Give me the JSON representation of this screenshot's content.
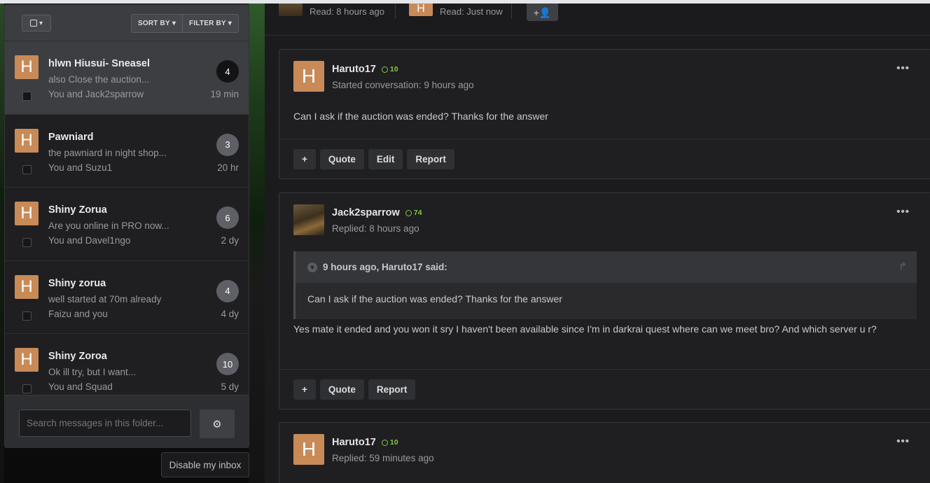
{
  "inbox": {
    "sort_label": "SORT BY",
    "filter_label": "FILTER BY",
    "conversations": [
      {
        "title": "hlwn Hiusui- Sneasel",
        "snippet": "also Close the auction...",
        "who": "You and Jack2sparrow",
        "count": "4",
        "time": "19 min",
        "avatar": "H",
        "active": true
      },
      {
        "title": "Pawniard",
        "snippet": "the pawniard in night shop...",
        "who": "You and Suzu1",
        "count": "3",
        "time": "20 hr",
        "avatar": "H"
      },
      {
        "title": "Shiny Zorua",
        "snippet": "Are you online in PRO now...",
        "who": "You and Davel1ngo",
        "count": "6",
        "time": "2 dy",
        "avatar": "H"
      },
      {
        "title": "Shiny zorua",
        "snippet": "well started at 70m already",
        "who": "Faizu and you",
        "count": "4",
        "time": "4 dy",
        "avatar": "H"
      },
      {
        "title": "Shiny Zoroa",
        "snippet": "Ok ill try, but I want...",
        "who": "You and Squad",
        "count": "10",
        "time": "5 dy",
        "avatar": "H"
      }
    ],
    "search_placeholder": "Search messages in this folder...",
    "disable_label": "Disable my inbox"
  },
  "participants": {
    "first_read": "Read: 8 hours ago",
    "second_read": "Read: Just now",
    "second_avatar": "H"
  },
  "messages": [
    {
      "author": "Haruto17",
      "rep": "10",
      "meta": "Started conversation: 9 hours ago",
      "body": "Can I ask if the auction was ended? Thanks for the answer",
      "actions": [
        "+",
        "Quote",
        "Edit",
        "Report"
      ],
      "avatar": "H"
    },
    {
      "author": "Jack2sparrow",
      "rep": "74",
      "meta": "Replied: 8 hours ago",
      "quote_header": "9 hours ago, Haruto17 said:",
      "quote_body": "Can I ask if the auction was ended? Thanks for the answer",
      "body": "Yes mate it ended and you won it sry I haven't been available since I'm in darkrai quest where can we meet bro? And which server u r?",
      "actions": [
        "+",
        "Quote",
        "Report"
      ]
    },
    {
      "author": "Haruto17",
      "rep": "10",
      "meta": "Replied: 59 minutes ago",
      "avatar": "H"
    }
  ],
  "icons": {
    "more": "•••",
    "gear": "⚙",
    "add_participant": "+👤",
    "select": "▾"
  }
}
